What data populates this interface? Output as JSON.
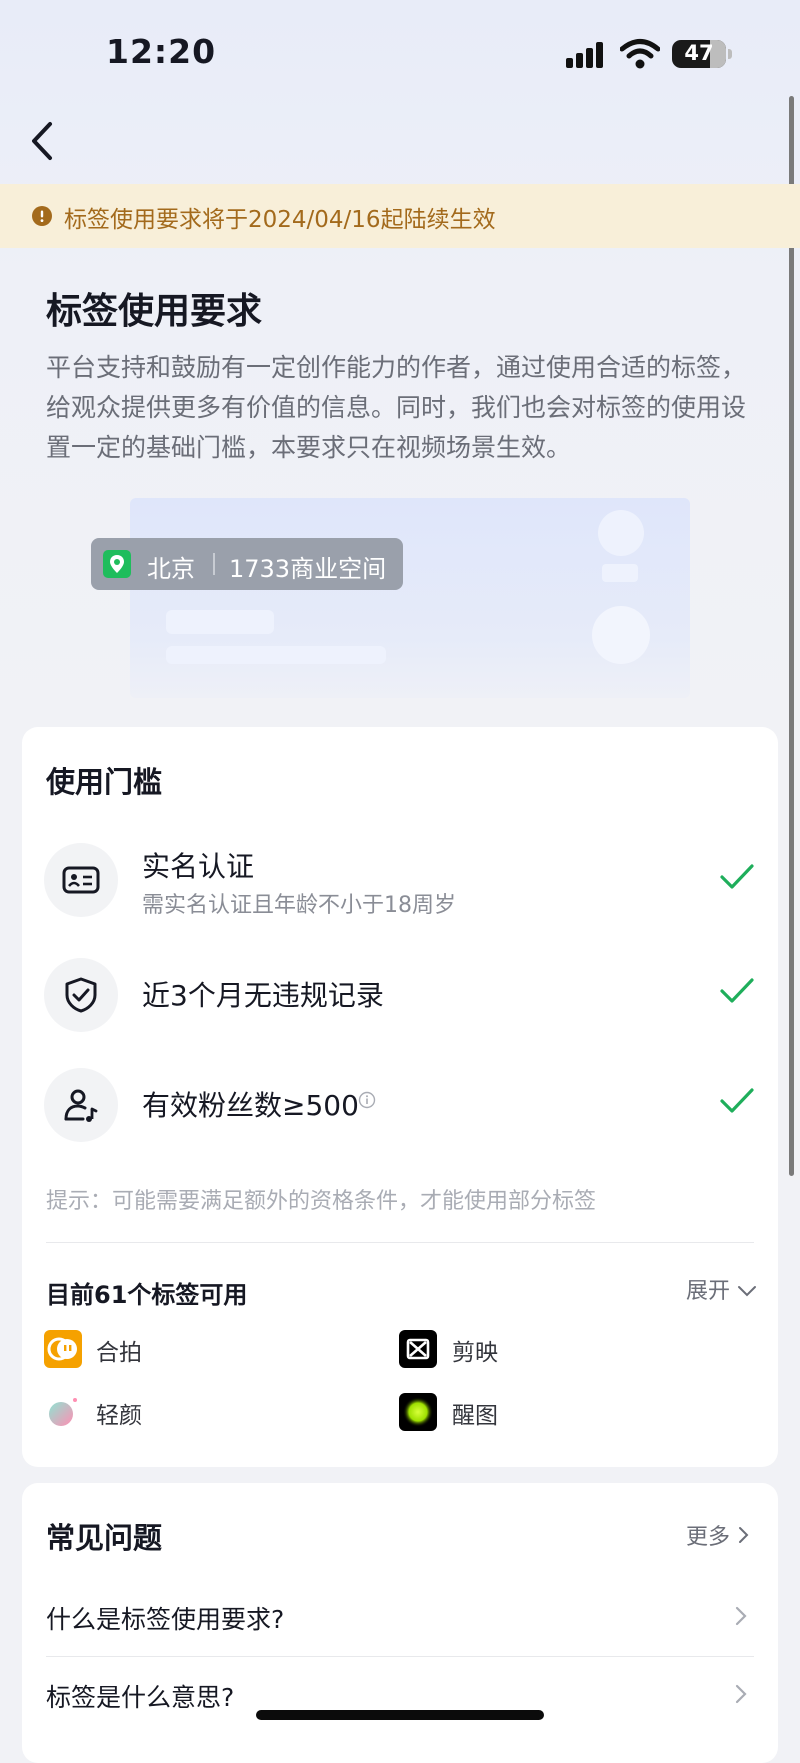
{
  "status_bar": {
    "time": "12:20",
    "battery": "47"
  },
  "notice": {
    "text": "标签使用要求将于2024/04/16起陆续生效"
  },
  "header": {
    "title": "标签使用要求",
    "description": "平台支持和鼓励有一定创作能力的作者，通过使用合适的标签，给观众提供更多有价值的信息。同时，我们也会对标签的使用设置一定的基础门槛，本要求只在视频场景生效。"
  },
  "illustration": {
    "city": "北京",
    "place": "1733商业空间"
  },
  "threshold": {
    "title": "使用门槛",
    "items": [
      {
        "title": "实名认证",
        "subtitle": "需实名认证且年龄不小于18周岁",
        "icon": "id-card-icon",
        "met": true
      },
      {
        "title": "近3个月无违规记录",
        "icon": "shield-check-icon",
        "met": true
      },
      {
        "title": "有效粉丝数≥500",
        "icon": "user-music-icon",
        "met": true
      }
    ],
    "tip": "提示：可能需要满足额外的资格条件，才能使用部分标签",
    "available": "目前61个标签可用",
    "expand": "展开",
    "apps": [
      {
        "name": "合拍",
        "color": "#f5a100"
      },
      {
        "name": "剪映",
        "color": "#000000"
      },
      {
        "name": "轻颜",
        "color": "#f7a8c4"
      },
      {
        "name": "醒图",
        "color": "#000000"
      }
    ]
  },
  "faq": {
    "title": "常见问题",
    "more": "更多",
    "questions": [
      "什么是标签使用要求?",
      "标签是什么意思?"
    ]
  },
  "colors": {
    "accent_green": "#1fae5b",
    "notice_text": "#a36a1c",
    "notice_bg": "#f8efd9"
  }
}
